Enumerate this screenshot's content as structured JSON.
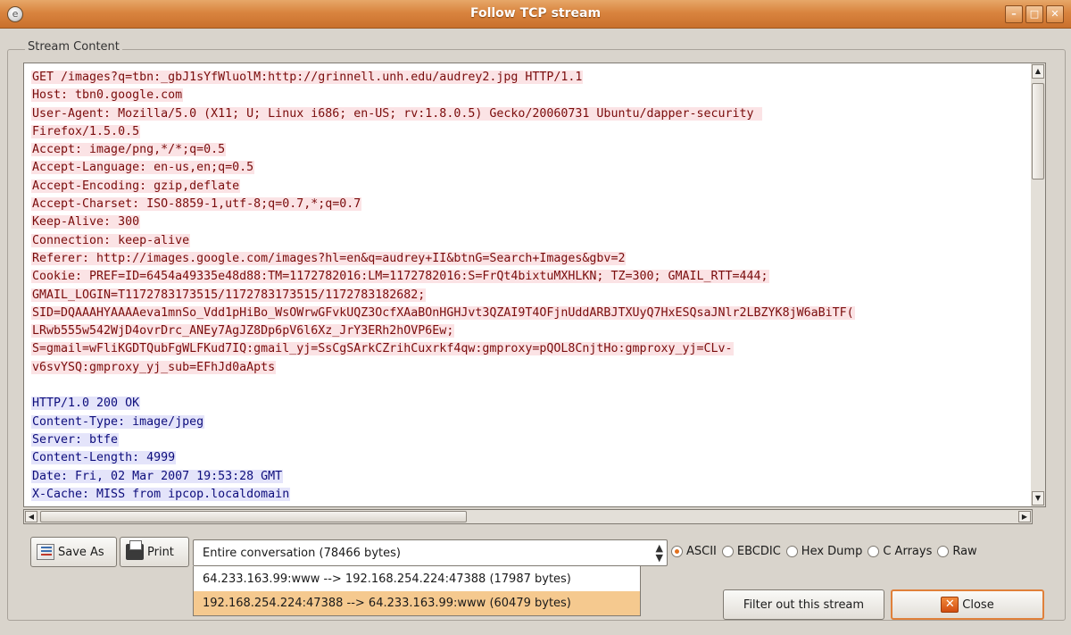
{
  "window": {
    "title": "Follow TCP stream",
    "controls": {
      "minimize": "–",
      "maximize": "□",
      "close": "✕"
    }
  },
  "frame_label": "Stream Content",
  "stream": {
    "client_lines": [
      "GET /images?q=tbn:_gbJ1sYfWluolM:http://grinnell.unh.edu/audrey2.jpg HTTP/1.1",
      "Host: tbn0.google.com",
      "User-Agent: Mozilla/5.0 (X11; U; Linux i686; en-US; rv:1.8.0.5) Gecko/20060731 Ubuntu/dapper-security ",
      "Firefox/1.5.0.5",
      "Accept: image/png,*/*;q=0.5",
      "Accept-Language: en-us,en;q=0.5",
      "Accept-Encoding: gzip,deflate",
      "Accept-Charset: ISO-8859-1,utf-8;q=0.7,*;q=0.7",
      "Keep-Alive: 300",
      "Connection: keep-alive",
      "Referer: http://images.google.com/images?hl=en&q=audrey+II&btnG=Search+Images&gbv=2",
      "Cookie: PREF=ID=6454a49335e48d88:TM=1172782016:LM=1172782016:S=FrQt4bixtuMXHLKN; TZ=300; GMAIL_RTT=444;",
      "GMAIL_LOGIN=T1172783173515/1172783173515/1172783182682;",
      "SID=DQAAAHYAAAAeva1mnSo_Vdd1pHiBo_WsOWrwGFvkUQZ3OcfXAaBOnHGHJvt3QZAI9T4OFjnUddARBJTXUyQ7HxESQsaJNlr2LBZYK8jW6aBiTF(",
      "LRwb555w542WjD4ovrDrc_ANEy7AgJZ8Dp6pV6l6Xz_JrY3ERh2hOVP6Ew;",
      "S=gmail=wFliKGDTQubFgWLFKud7IQ:gmail_yj=SsCgSArkCZrihCuxrkf4qw:gmproxy=pQOL8CnjtHo:gmproxy_yj=CLv-",
      "v6svYSQ:gmproxy_yj_sub=EFhJd0aApts"
    ],
    "server_lines": [
      "HTTP/1.0 200 OK",
      "Content-Type: image/jpeg",
      "Server: btfe",
      "Content-Length: 4999",
      "Date: Fri, 02 Mar 2007 19:53:28 GMT",
      "X-Cache: MISS from ipcop.localdomain"
    ]
  },
  "buttons": {
    "save_as": "Save As",
    "print": "Print",
    "filter": "Filter out this stream",
    "close": "Close"
  },
  "conversation_select": {
    "selected": "Entire conversation (78466 bytes)",
    "options": [
      "64.233.163.99:www --> 192.168.254.224:47388 (17987 bytes)",
      "192.168.254.224:47388 --> 64.233.163.99:www (60479 bytes)"
    ],
    "highlighted_index": 1
  },
  "format_options": {
    "items": [
      "ASCII",
      "EBCDIC",
      "Hex Dump",
      "C Arrays",
      "Raw"
    ],
    "selected": "ASCII"
  },
  "colors": {
    "client_text": "#7a0c0c",
    "client_bg": "#fbe3e5",
    "server_text": "#0d0d7c",
    "server_bg": "#e4e4fa",
    "title_bar": "#d9843f",
    "highlight": "#f5c98f"
  },
  "icons": {
    "app": "app-icon",
    "save": "save-icon",
    "print": "printer-icon",
    "close": "close-icon"
  }
}
